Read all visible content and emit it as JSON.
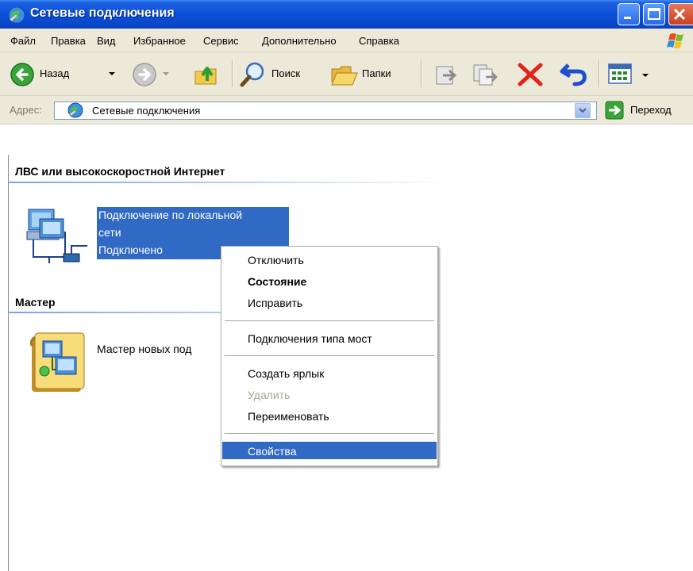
{
  "window": {
    "title": "Сетевые подключения"
  },
  "menu": [
    "Файл",
    "Правка",
    "Вид",
    "Избранное",
    "Сервис",
    "Дополнительно",
    "Справка"
  ],
  "toolbar": {
    "back_label": "Назад",
    "search_label": "Поиск",
    "folders_label": "Папки"
  },
  "address": {
    "label": "Адрес:",
    "value": "Сетевые подключения",
    "go_label": "Переход"
  },
  "groups": {
    "lan": {
      "heading": "ЛВС или высокоскоростной Интернет",
      "item": {
        "name_line1": "Подключение по локальной",
        "name_line2": "сети",
        "status": "Подключено"
      }
    },
    "wizard": {
      "heading": "Мастер",
      "item": {
        "name": "Мастер новых под"
      }
    }
  },
  "context_menu": {
    "items": [
      {
        "label": "Отключить"
      },
      {
        "label": "Состояние"
      },
      {
        "label": "Исправить"
      },
      {
        "label": "Подключения типа мост"
      },
      {
        "label": "Создать ярлык"
      },
      {
        "label": "Удалить"
      },
      {
        "label": "Переименовать"
      },
      {
        "label": "Свойства"
      }
    ]
  },
  "icons": {
    "title": "network-connections-icon",
    "back": "back-arrow-icon",
    "forward": "forward-arrow-icon",
    "up": "up-folder-icon",
    "search": "search-magnifier-icon",
    "folders": "folders-icon",
    "move_to": "move-to-icon",
    "copy_to": "copy-to-icon",
    "delete": "delete-x-icon",
    "undo": "undo-icon",
    "views": "views-icon",
    "go": "go-arrow-icon",
    "lan": "lan-connection-icon",
    "wizard": "new-connection-wizard-icon"
  },
  "colors": {
    "titlebar": "#0a4fd8",
    "selection": "#316ac5",
    "chrome": "#ece9d8"
  }
}
